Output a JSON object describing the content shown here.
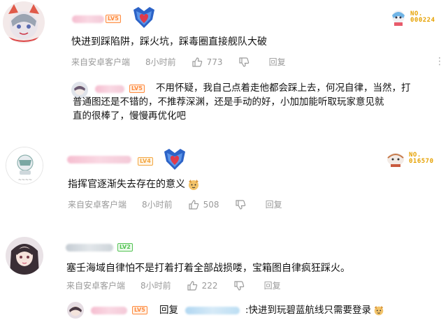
{
  "comments": [
    {
      "fan_no_label": "NO.",
      "fan_no_value": "000224",
      "level": "LV5",
      "text": "快进到踩陷阱，踩火坑，踩毒圈直接舰队大破",
      "source": "来自安卓客户端",
      "time": "8小时前",
      "likes": "773",
      "reply_label": "回复",
      "sub_reply": {
        "level": "LV5",
        "text_line1": "不用怀疑，我自己点着走他都会踩上去，何况自律，当然，打",
        "text_line2": "普通图还是不错的，不推荐深渊，还是手动的好，小加加能听取玩家意见就",
        "text_line3": "直的很棒了，慢慢再优化吧"
      }
    },
    {
      "fan_no_label": "NO.",
      "fan_no_value": "016570",
      "level": "LV4",
      "text": "指挥官逐渐失去存在的意义",
      "source": "来自安卓客户端",
      "time": "8小时前",
      "likes": "508",
      "reply_label": "回复"
    },
    {
      "level": "LV2",
      "text": "塞壬海域自律怕不是打着打着全部战损喽，宝箱图自律疯狂踩火。",
      "source": "来自安卓客户端",
      "time": "8小时前",
      "likes": "222",
      "reply_label": "回复",
      "sub_reply": {
        "level": "LV5",
        "reply_prefix": "回复",
        "text": ":快进到玩碧蓝航线只需要登录"
      }
    }
  ],
  "colors": {
    "accent_pink": "#f5b8cc",
    "meta_gray": "#9a9a9a",
    "medal_red": "#e03a4a"
  }
}
